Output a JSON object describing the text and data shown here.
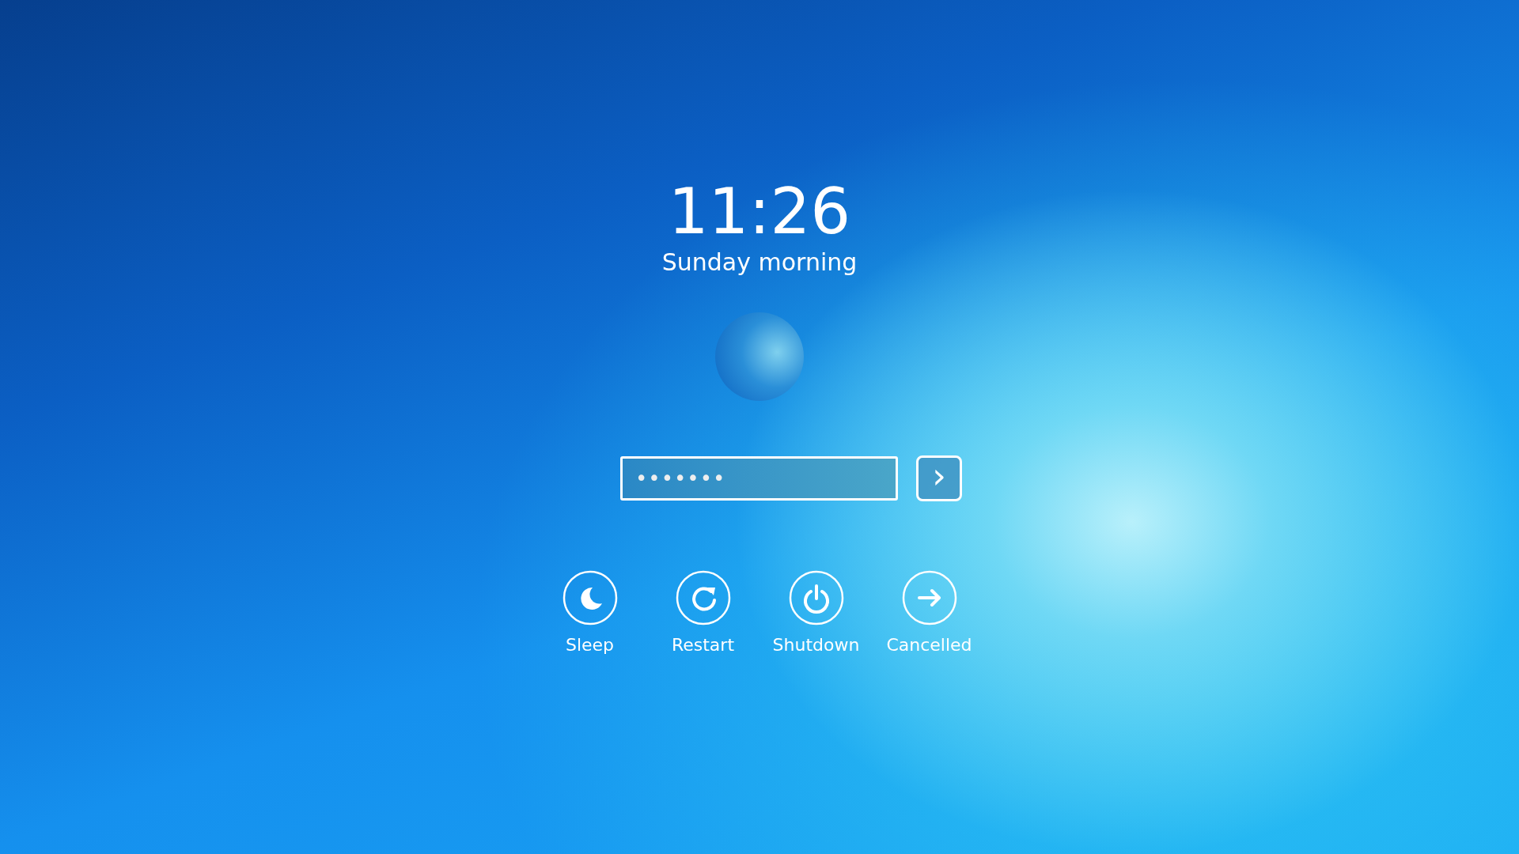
{
  "clock": {
    "time": "11:26",
    "greeting": "Sunday morning"
  },
  "password": {
    "value": "•••••••"
  },
  "submit": {
    "label": "›"
  },
  "actions": [
    {
      "kind": "sleep",
      "label": "Sleep"
    },
    {
      "kind": "restart",
      "label": "Restart"
    },
    {
      "kind": "shutdown",
      "label": "Shutdown"
    },
    {
      "kind": "cancel",
      "label": "Cancelled"
    }
  ]
}
